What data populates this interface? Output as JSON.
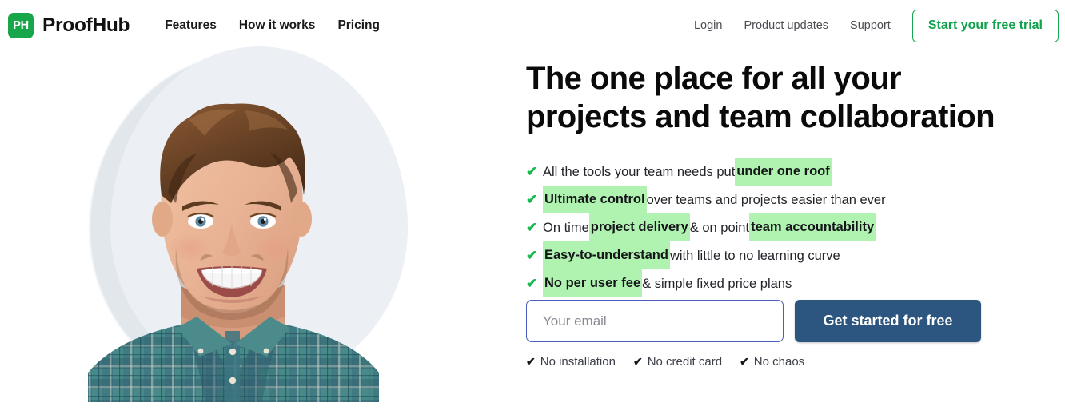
{
  "header": {
    "logo": {
      "mark_text": "PH",
      "mark_color": "#17a74a",
      "wordmark": "ProofHub",
      "icon": "proofhub-logo-icon"
    },
    "nav_main": [
      {
        "label": "Features"
      },
      {
        "label": "How it works"
      },
      {
        "label": "Pricing"
      }
    ],
    "nav_secondary": [
      {
        "label": "Login"
      },
      {
        "label": "Product updates"
      },
      {
        "label": "Support"
      }
    ],
    "trial_button": {
      "label": "Start your free trial",
      "border_color": "#14a84f",
      "text_color": "#10a24b"
    }
  },
  "hero": {
    "image_alt": "smiling-man-in-teal-plaid-shirt",
    "headline_line1": "The one place for all your",
    "headline_line2": "projects and team collaboration",
    "check_icon": "✔",
    "highlight_color": "#b0f3b0",
    "check_color": "#16b84f",
    "benefits": [
      {
        "pre": "All the tools your team needs put ",
        "highlight": "under one roof",
        "post": ""
      },
      {
        "pre": "",
        "highlight": "Ultimate control",
        "post": " over teams and projects easier than ever"
      },
      {
        "pre": "On time ",
        "highlight": "project delivery",
        "mid": " & on point ",
        "highlight2": "team accountability",
        "post": ""
      },
      {
        "pre": "",
        "highlight": "Easy-to-understand",
        "post": " with little to no learning curve"
      },
      {
        "pre": "",
        "highlight": "No per user fee",
        "post": " & simple fixed price plans"
      }
    ]
  },
  "form": {
    "email_placeholder": "Your email",
    "email_value": "",
    "submit_label": "Get started for free",
    "submit_color": "#2c5680",
    "input_border_color": "#4d5bbd"
  },
  "assurances": {
    "check_icon": "✔",
    "items": [
      {
        "label": "No installation"
      },
      {
        "label": "No credit card"
      },
      {
        "label": "No chaos"
      }
    ]
  }
}
